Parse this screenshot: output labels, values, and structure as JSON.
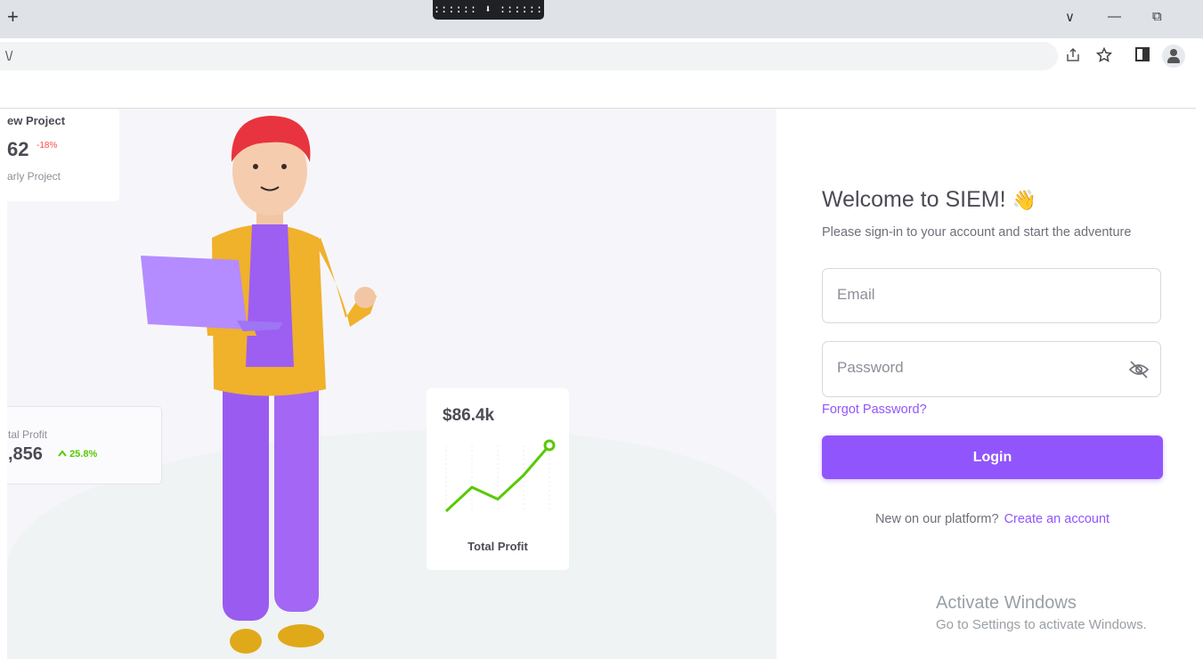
{
  "browser": {
    "new_tab": "+",
    "download_indicator": ":::::: ⬇ ::::::",
    "window_controls": {
      "chevron": "∨",
      "minimize": "—",
      "restore": "⧉"
    },
    "address": "\\/",
    "icons": [
      "share-icon",
      "star-icon",
      "sidebar-icon",
      "profile-icon"
    ]
  },
  "cards": {
    "new_project": {
      "title": "ew Project",
      "value": "62",
      "delta": "-18%",
      "subtitle": "arly Project"
    },
    "total_profit_left": {
      "label": "tal Profit",
      "value": ",856",
      "delta": "25.8%"
    },
    "total_profit_right": {
      "value": "$86.4k",
      "label": "Total Profit"
    }
  },
  "chart_data": {
    "type": "line",
    "title": "",
    "x": [
      0,
      1,
      2,
      3,
      4
    ],
    "series": [
      {
        "values": [
          1,
          3,
          2,
          4,
          6.5
        ],
        "color": "#56ca00"
      }
    ]
  },
  "login": {
    "title": "Welcome to SIEM!",
    "wave_emoji": "👋",
    "subtitle": "Please sign-in to your account and start the adventure",
    "email_placeholder": "Email",
    "password_placeholder": "Password",
    "forgot": "Forgot Password?",
    "login_button": "Login",
    "new_text": "New on our platform?",
    "create_account": "Create an account"
  },
  "watermark": {
    "title": "Activate Windows",
    "subtitle": "Go to Settings to activate Windows."
  },
  "colors": {
    "primary": "#9155fd",
    "success": "#56ca00",
    "error": "#ff4c51"
  }
}
